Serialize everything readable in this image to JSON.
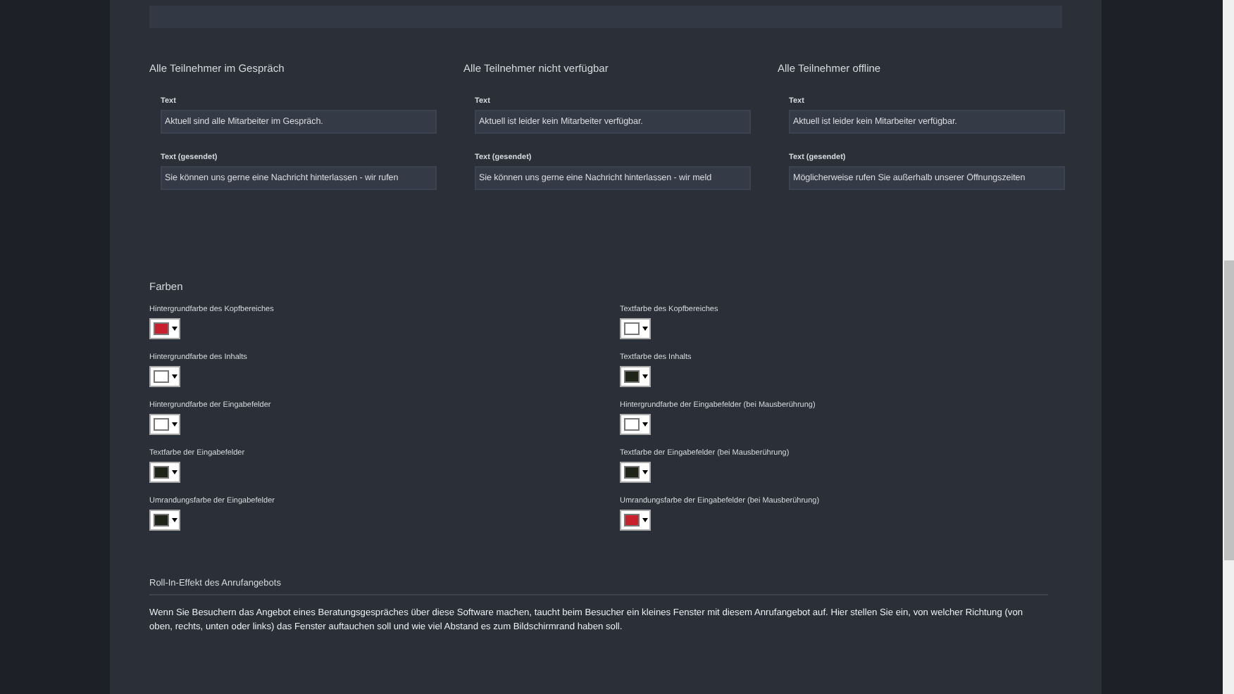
{
  "groups": [
    {
      "heading": "Alle Teilnehmer im Gespräch",
      "fields": [
        {
          "label": "Text",
          "value": "Aktuell sind alle Mitarbeiter im Gespräch."
        },
        {
          "label": "Text (gesendet)",
          "value": "Sie können uns gerne eine Nachricht hinterlassen - wir rufen"
        }
      ]
    },
    {
      "heading": "Alle Teilnehmer nicht verfügbar",
      "fields": [
        {
          "label": "Text",
          "value": "Aktuell ist leider kein Mitarbeiter verfügbar."
        },
        {
          "label": "Text (gesendet)",
          "value": "Sie können uns gerne eine Nachricht hinterlassen - wir meld"
        }
      ]
    },
    {
      "heading": "Alle Teilnehmer offline",
      "fields": [
        {
          "label": "Text",
          "value": "Aktuell ist leider kein Mitarbeiter verfügbar."
        },
        {
          "label": "Text (gesendet)",
          "value": "Möglicherweise rufen Sie außerhalb unserer Öffnungszeiten"
        }
      ]
    }
  ],
  "colors": {
    "heading": "Farben",
    "items": [
      {
        "label": "Hintergrundfarbe des Kopfbereiches",
        "color": "#c8202c"
      },
      {
        "label": "Textfarbe des Kopfbereiches",
        "color": "#ffffff"
      },
      {
        "label": "Hintergrundfarbe des Inhalts",
        "color": "#ffffff"
      },
      {
        "label": "Textfarbe des Inhalts",
        "color": "#1f2419"
      },
      {
        "label": "Hintergrundfarbe der Eingabefelder",
        "color": "#ffffff"
      },
      {
        "label": "Hintergrundfarbe der Eingabefelder (bei Mausberührung)",
        "color": "#ffffff"
      },
      {
        "label": "Textfarbe der Eingabefelder",
        "color": "#1f2419"
      },
      {
        "label": "Textfarbe der Eingabefelder (bei Mausberührung)",
        "color": "#1f2419"
      },
      {
        "label": "Umrandungsfarbe der Eingabefelder",
        "color": "#1f2419"
      },
      {
        "label": "Umrandungsfarbe der Eingabefelder (bei Mausberührung)",
        "color": "#c8202c"
      }
    ]
  },
  "roll_in": {
    "heading": "Roll-In-Effekt des Anrufangebots",
    "text": "Wenn Sie Besuchern das Angebot eines Beratungsgespräches über diese Software machen, taucht beim Besucher ein kleines Fenster mit diesem Anrufangebot auf. Hier stellen Sie ein, von welcher Richtung (von oben, rechts, unten oder links) das Fenster auftauchen soll und wie viel Abstand es zum Bildschirmrand haben soll."
  }
}
